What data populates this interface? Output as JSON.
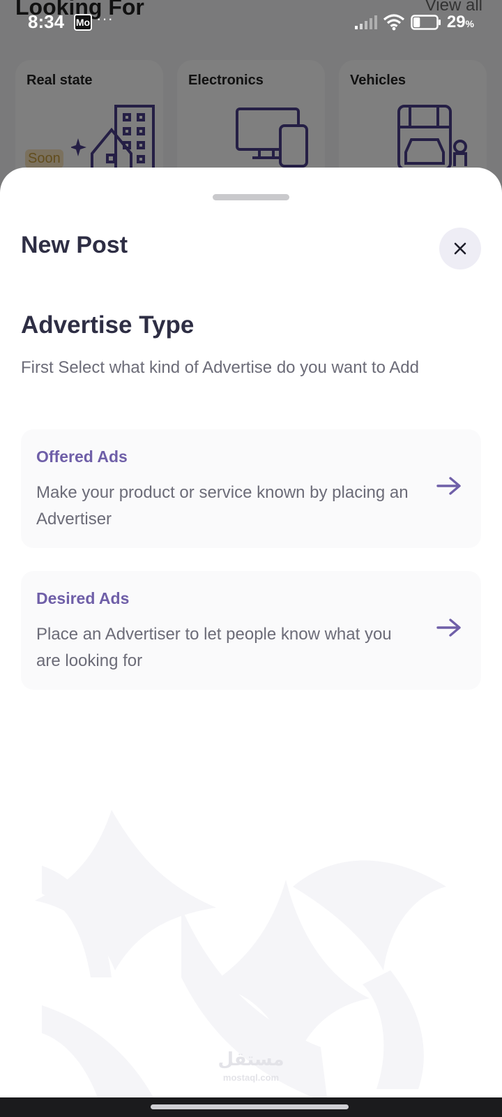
{
  "status_bar": {
    "time": "8:34",
    "app_icon_text": "Mo",
    "notification_dots": "···",
    "battery_text": "29",
    "battery_unit": "%",
    "battery_level": 0.29
  },
  "background_screen": {
    "title": "Looking For",
    "view_all": "View all",
    "categories": [
      {
        "label": "Real state",
        "icon": "buildings-icon",
        "badge": "Soon"
      },
      {
        "label": "Electronics",
        "icon": "devices-icon"
      },
      {
        "label": "Vehicles",
        "icon": "vehicles-icon"
      }
    ]
  },
  "sheet": {
    "title": "New Post",
    "close_icon": "close-icon",
    "section_title": "Advertise Type",
    "section_description": "First Select what kind of Advertise do you want to Add",
    "options": [
      {
        "title": "Offered Ads",
        "description": "Make your product or service known by placing an Advertiser",
        "icon": "arrow-right-icon"
      },
      {
        "title": "Desired Ads",
        "description": "Place an Advertiser to let people know what you are looking for",
        "icon": "arrow-right-icon"
      }
    ],
    "watermark_arabic": "مستقل",
    "watermark_url": "mostaql.com"
  },
  "colors": {
    "accent": "#6f5fa8",
    "title": "#2e2e44",
    "body_text": "#6c6c78",
    "card_bg": "#fafafb",
    "close_bg": "#eeedf5"
  }
}
